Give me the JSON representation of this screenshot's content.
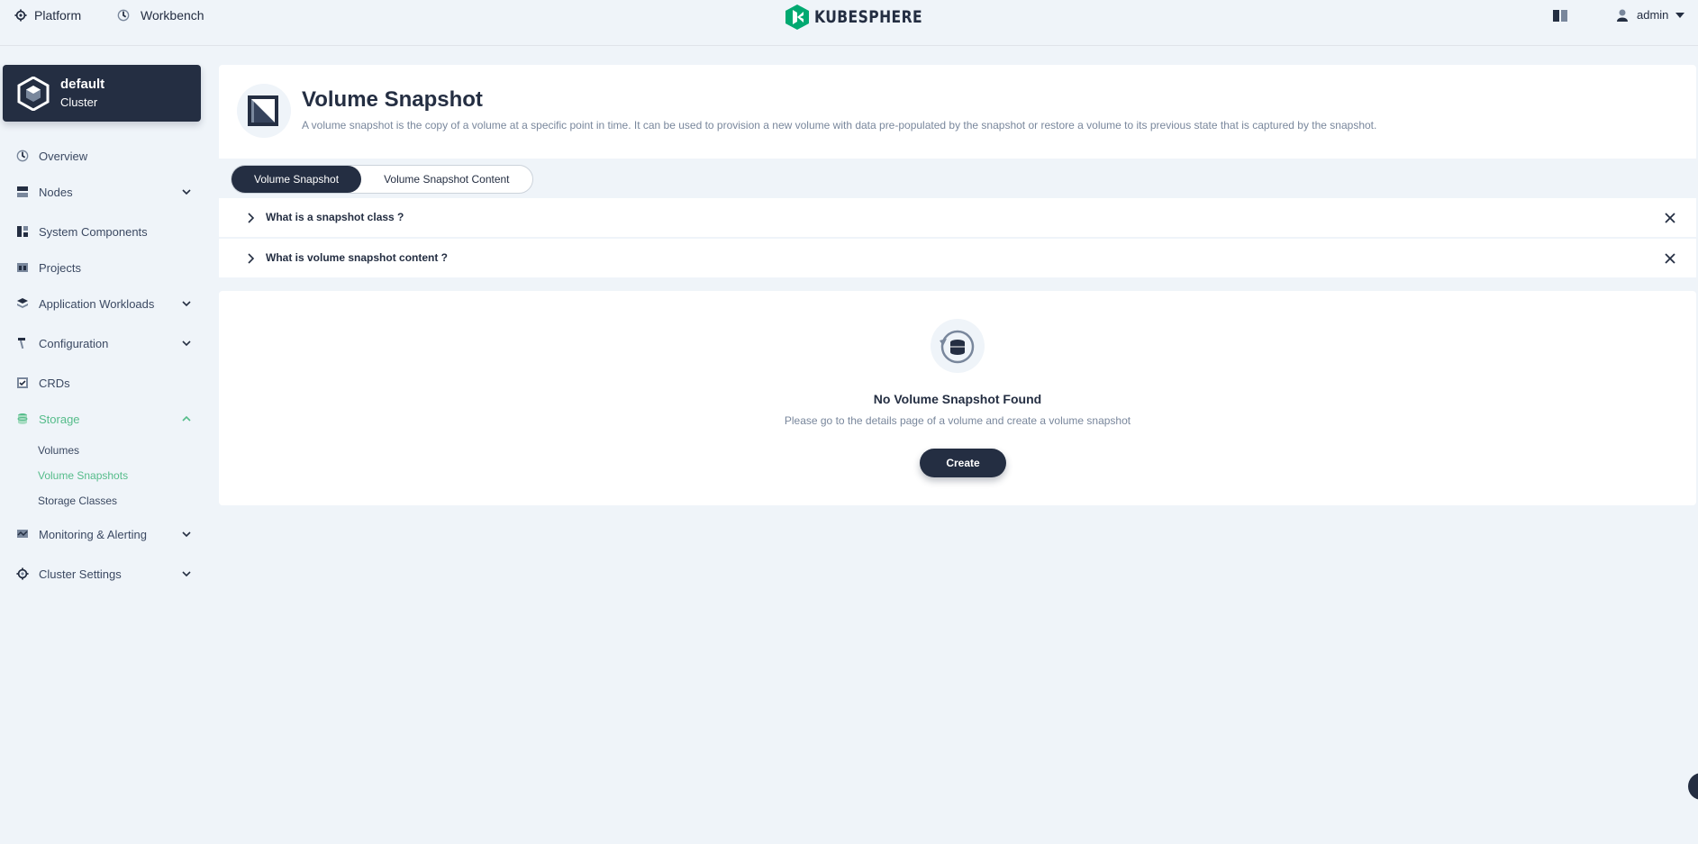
{
  "topbar": {
    "platform_label": "Platform",
    "workbench_label": "Workbench",
    "logo_text": "KUBESPHERE",
    "user_name": "admin"
  },
  "sidebar": {
    "cluster_name": "default",
    "cluster_type": "Cluster",
    "items": [
      {
        "label": "Overview",
        "icon": "dashboard-icon"
      },
      {
        "label": "Nodes",
        "icon": "nodes-icon"
      },
      {
        "label": "System Components",
        "icon": "components-icon"
      },
      {
        "label": "Projects",
        "icon": "projects-icon"
      },
      {
        "label": "Application Workloads",
        "icon": "workloads-icon"
      },
      {
        "label": "Configuration",
        "icon": "hammer-icon"
      },
      {
        "label": "CRDs",
        "icon": "crd-icon"
      },
      {
        "label": "Storage",
        "icon": "storage-icon"
      },
      {
        "label": "Monitoring & Alerting",
        "icon": "monitor-icon"
      },
      {
        "label": "Cluster Settings",
        "icon": "gear-icon"
      }
    ],
    "storage_sub": [
      "Volumes",
      "Volume Snapshots",
      "Storage Classes"
    ]
  },
  "header": {
    "title": "Volume Snapshot",
    "description": "A volume snapshot is the copy of a volume at a specific point in time. It can be used to provision a new volume with data pre-populated by the snapshot or restore a volume to its previous state that is captured by the snapshot."
  },
  "tabs": [
    "Volume Snapshot",
    "Volume Snapshot Content"
  ],
  "faq": [
    "What is a snapshot class ?",
    "What is volume snapshot content ?"
  ],
  "empty": {
    "title": "No Volume Snapshot Found",
    "description": "Please go to the details page of a volume and create a volume snapshot",
    "create_label": "Create"
  },
  "colors": {
    "accent": "#55bc8a",
    "dark": "#242e42",
    "background": "#eff4f9"
  }
}
